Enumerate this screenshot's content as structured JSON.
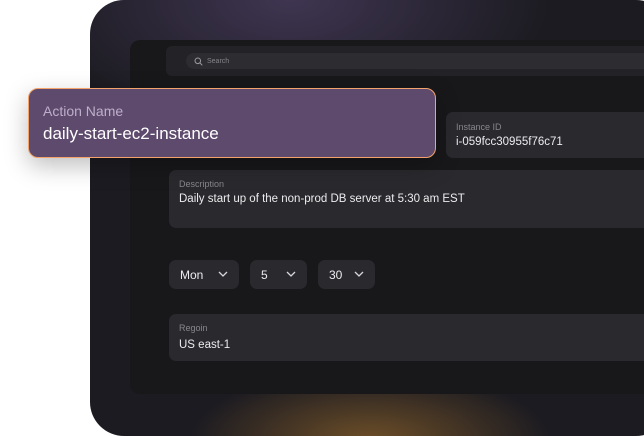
{
  "search": {
    "placeholder": "Search",
    "icon": "search-icon"
  },
  "action_name": {
    "label": "Action Name",
    "value": "daily-start-ec2-instance"
  },
  "instance": {
    "label": "Instance ID",
    "value": "i-059fcc30955f76c71"
  },
  "description": {
    "label": "Description",
    "value": "Daily start up of the non-prod DB server at 5:30 am EST"
  },
  "schedule": {
    "day": "Mon",
    "hour": "5",
    "minute": "30",
    "chevron_icon": "chevron-down-icon"
  },
  "region": {
    "label": "Regoin",
    "value": "US east-1"
  },
  "colors": {
    "device_bg": "#1c1b21",
    "panel_bg": "#18181b",
    "field_bg": "#2a2a2e",
    "card_bg": "#5d4a6c",
    "card_border": "#f3a36b"
  }
}
